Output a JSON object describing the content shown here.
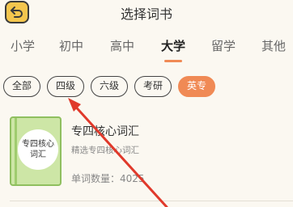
{
  "header": {
    "title": "选择词书",
    "back_icon": "back-arrow-icon",
    "back_color": "#f4c64e"
  },
  "tabs": [
    {
      "label": "小学"
    },
    {
      "label": "初中"
    },
    {
      "label": "高中"
    },
    {
      "label": "大学",
      "active": true
    },
    {
      "label": "留学"
    },
    {
      "label": "其他"
    }
  ],
  "chips": [
    {
      "label": "全部"
    },
    {
      "label": "四级"
    },
    {
      "label": "六级"
    },
    {
      "label": "考研"
    },
    {
      "label": "英专",
      "active": true
    }
  ],
  "book": {
    "cover_text": "专四核心\n词汇",
    "title": "专四核心词汇",
    "subtitle": "精选专四核心词汇",
    "count_label": "单词数量：",
    "count_value": "4025"
  },
  "colors": {
    "accent": "#f08a55",
    "background": "#fbf8f1",
    "cover": "#cde6a6",
    "annotation_arrow": "#e0392b"
  }
}
